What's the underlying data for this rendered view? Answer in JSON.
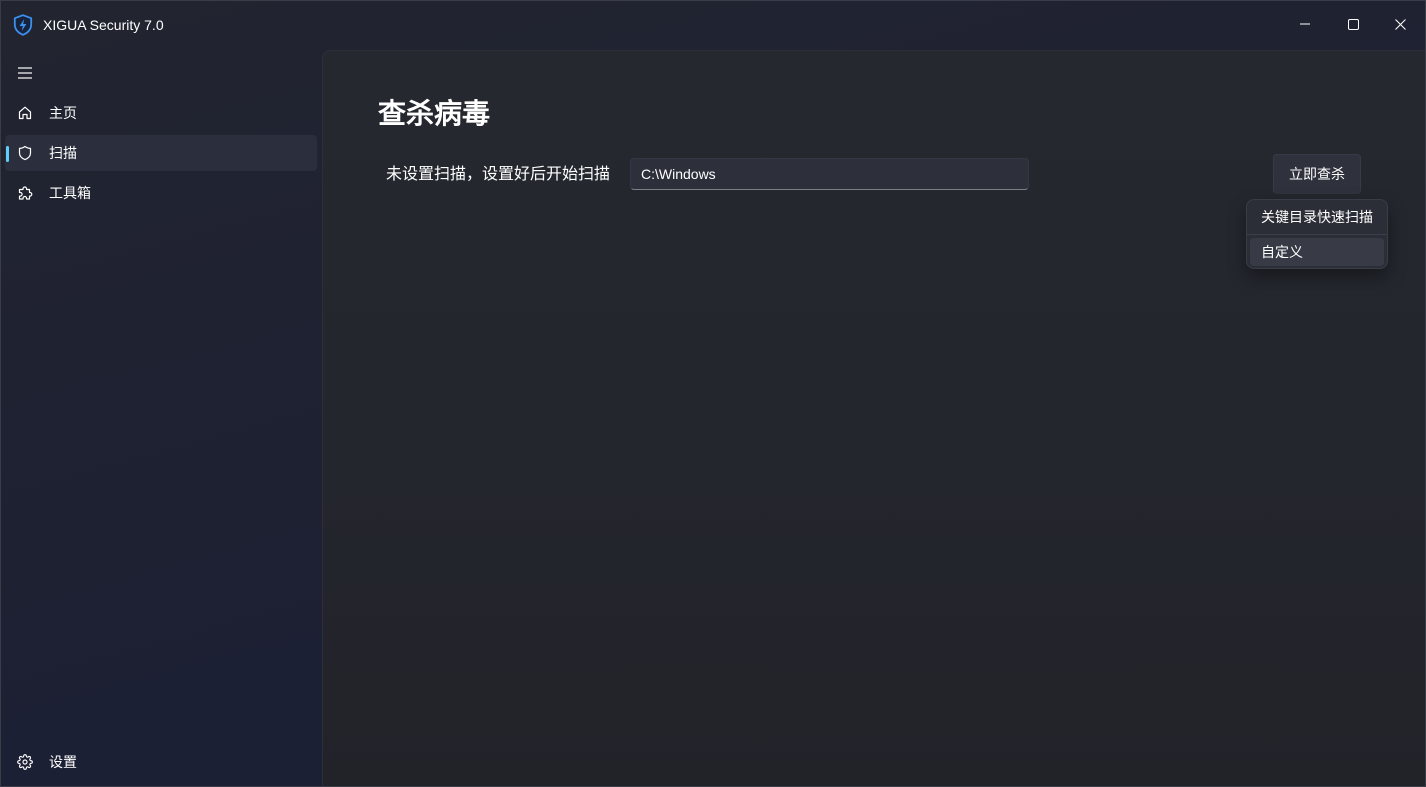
{
  "window": {
    "title": "XIGUA Security 7.0",
    "app_icon": "shield-lightning-icon",
    "controls": [
      "minimize-icon",
      "maximize-icon",
      "close-icon"
    ]
  },
  "sidebar": {
    "menu_icon": "hamburger-icon",
    "items": [
      {
        "label": "主页",
        "icon": "home-icon",
        "selected": false
      },
      {
        "label": "扫描",
        "icon": "shield-icon",
        "selected": true
      },
      {
        "label": "工具箱",
        "icon": "puzzle-icon",
        "selected": false
      }
    ],
    "footer": {
      "label": "设置",
      "icon": "gear-icon"
    }
  },
  "main": {
    "title": "查杀病毒",
    "scan_status": "未设置扫描，设置好后开始扫描",
    "path_input": {
      "value": "C:\\Windows"
    },
    "scan_button": "立即查杀",
    "scan_menu": {
      "items": [
        {
          "label": "关键目录快速扫描",
          "highlighted": false
        },
        {
          "label": "自定义",
          "highlighted": true
        }
      ]
    }
  },
  "colors": {
    "accent": "#60cdff",
    "app_icon": "#3d8ff0",
    "window_bg": "#1e2130",
    "panel_bg": "#24272f",
    "selected_nav_bg": "#2b2f3d"
  }
}
